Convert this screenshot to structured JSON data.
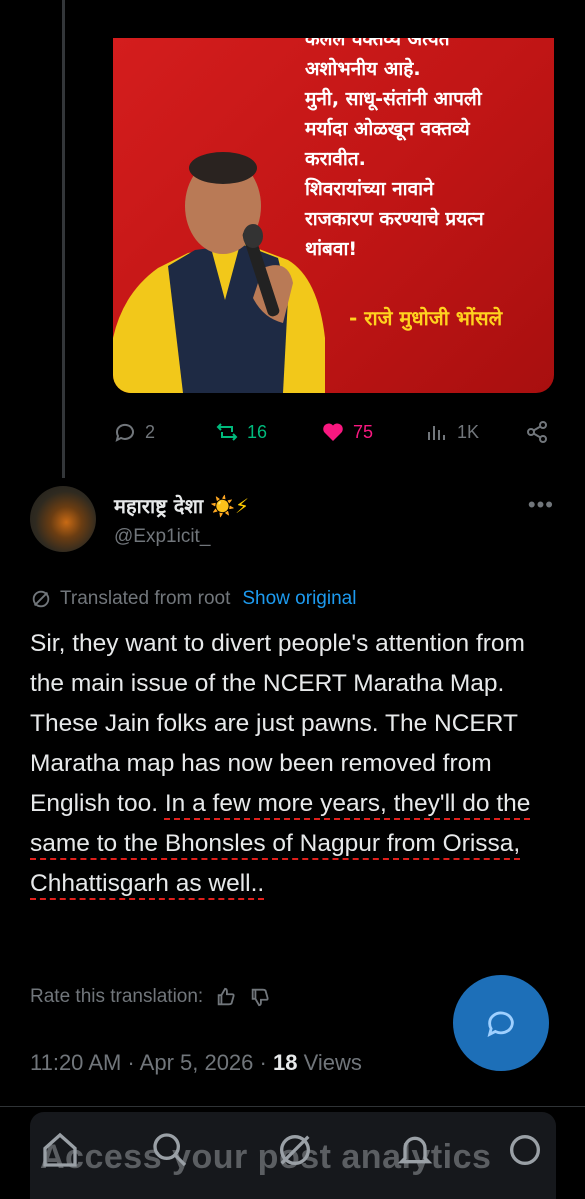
{
  "media": {
    "quote_lines": "कलल वक्तव्य अत्यंत\nअशोभनीय आहे.\nमुनी, साधू-संतांनी आपली\nमर्यादा ओळखून वक्तव्ये\nकरावीत.\nशिवरायांच्या नावाने\nराजकारण करण्याचे प्रयत्न\nथांबवा!",
    "author": "- राजे मुधोजी भोंसले"
  },
  "actions": {
    "replies": "2",
    "reposts": "16",
    "likes": "75",
    "views": "1K"
  },
  "tweet": {
    "display_name": "महाराष्ट्र देशा",
    "emoji_sun": "☀️",
    "emoji_bolt": "⚡",
    "handle": "@Exp1icit_",
    "more_glyph": "•••",
    "translated_label": "Translated from root",
    "show_original": "Show original",
    "text_plain": "Sir, they want to divert people's attention from the main issue of the NCERT Maratha Map. These Jain folks are just pawns. The NCERT Maratha map has now been removed from English too. ",
    "text_underlined": "In a few more years, they'll do the same to the Bhonsles of Nagpur from Orissa, Chhattisgarh as well..",
    "rate_label": "Rate this translation:",
    "time": "11:20 AM · Apr 5, 2026 · ",
    "views_count": "18",
    "views_label": " Views"
  },
  "bottom": {
    "analytics_text": "Access your post analytics"
  },
  "colors": {
    "accent": "#1d9bf0",
    "like": "#f91880",
    "repost": "#00ba7c",
    "underline": "#e0201c"
  }
}
